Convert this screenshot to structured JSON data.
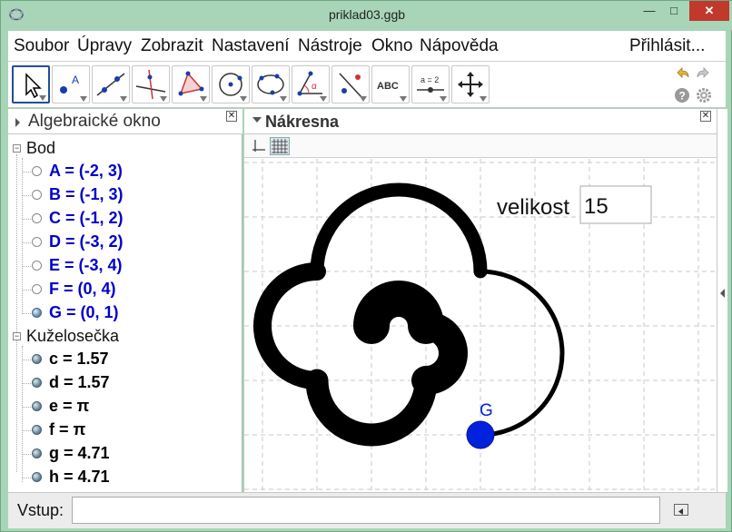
{
  "window": {
    "title": "priklad03.ggb",
    "app_icon": "geogebra-icon",
    "min_label": "—",
    "max_label": "□",
    "close_label": "✕"
  },
  "menu": {
    "items": [
      "Soubor",
      "Úpravy",
      "Zobrazit",
      "Nastavení",
      "Nástroje",
      "Okno",
      "Nápověda"
    ],
    "login": "Přihlásit..."
  },
  "toolbar": {
    "tools": [
      "move-tool",
      "point-tool",
      "line-tool",
      "perpendicular-line-tool",
      "polygon-tool",
      "circle-center-point-tool",
      "conic-five-points-tool",
      "angle-tool",
      "reflect-tool",
      "text-tool",
      "slider-tool",
      "move-graphics-tool"
    ],
    "text_tool_label": "ABC",
    "slider_tool_label": "a = 2",
    "angle_tool_label": "α",
    "point_tool_label": "A"
  },
  "algebra": {
    "title": "Algebraické okno",
    "groups": [
      {
        "name": "Bod",
        "items": [
          {
            "text": "A = (-2, 3)",
            "color": "#0000cc",
            "bullet": "hollow"
          },
          {
            "text": "B = (-1, 3)",
            "color": "#0000cc",
            "bullet": "hollow"
          },
          {
            "text": "C = (-1, 2)",
            "color": "#0000cc",
            "bullet": "hollow"
          },
          {
            "text": "D = (-3, 2)",
            "color": "#0000cc",
            "bullet": "hollow"
          },
          {
            "text": "E = (-3, 4)",
            "color": "#0000cc",
            "bullet": "hollow"
          },
          {
            "text": "F = (0, 4)",
            "color": "#0000cc",
            "bullet": "hollow"
          },
          {
            "text": "G = (0, 1)",
            "color": "#0000cc",
            "bullet": "filled"
          }
        ]
      },
      {
        "name": "Kuželosečka",
        "items": [
          {
            "text": "c = 1.57",
            "color": "#000000",
            "bullet": "dark"
          },
          {
            "text": "d = 1.57",
            "color": "#000000",
            "bullet": "dark"
          },
          {
            "text": "e = π",
            "color": "#000000",
            "bullet": "dark"
          },
          {
            "text": "f = π",
            "color": "#000000",
            "bullet": "dark"
          },
          {
            "text": "g = 4.71",
            "color": "#000000",
            "bullet": "dark"
          },
          {
            "text": "h = 4.71",
            "color": "#000000",
            "bullet": "dark"
          }
        ]
      }
    ]
  },
  "graphics": {
    "title": "Nákresna",
    "velikost_label": "velikost",
    "velikost_value": "15",
    "point_label": "G",
    "point_color": "#0022dd",
    "curve_color": "#000000"
  },
  "input": {
    "label": "Vstup:",
    "value": ""
  }
}
